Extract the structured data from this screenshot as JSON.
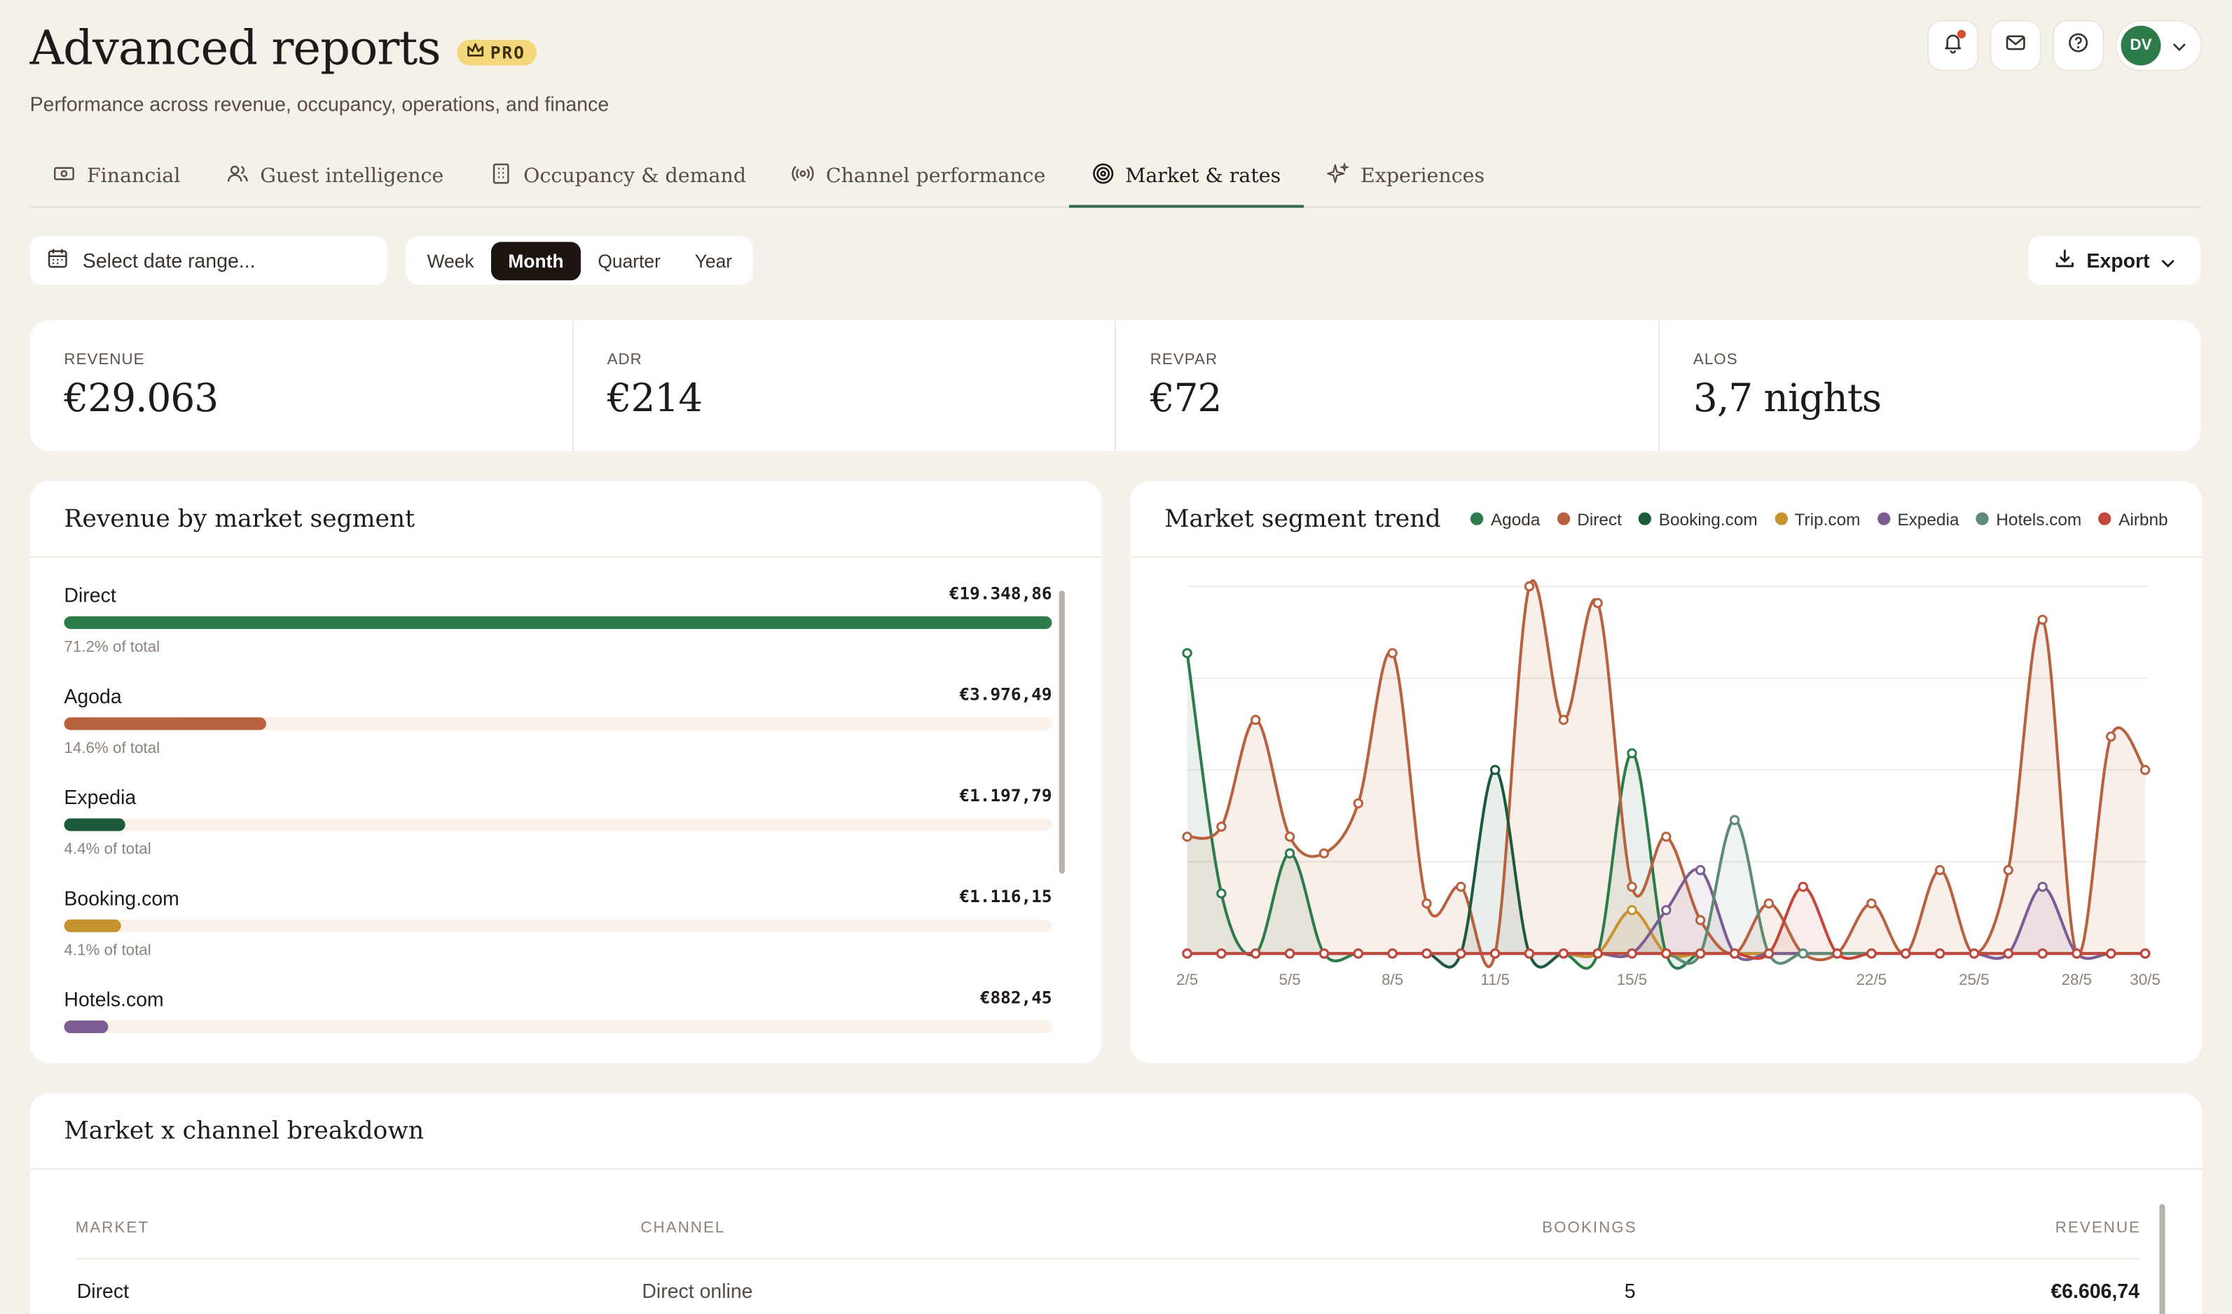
{
  "header": {
    "title": "Advanced reports",
    "badge": "PRO",
    "subtitle": "Performance across revenue, occupancy, operations, and finance",
    "user_initials": "DV"
  },
  "tabs": [
    {
      "label": "Financial",
      "icon": "banknote-icon"
    },
    {
      "label": "Guest intelligence",
      "icon": "users-icon"
    },
    {
      "label": "Occupancy & demand",
      "icon": "building-icon"
    },
    {
      "label": "Channel performance",
      "icon": "broadcast-icon"
    },
    {
      "label": "Market & rates",
      "icon": "target-icon",
      "active": true
    },
    {
      "label": "Experiences",
      "icon": "sparkles-icon"
    }
  ],
  "toolbar": {
    "date_placeholder": "Select date range...",
    "periods": [
      "Week",
      "Month",
      "Quarter",
      "Year"
    ],
    "active_period": "Month",
    "export_label": "Export"
  },
  "kpis": [
    {
      "label": "REVENUE",
      "value": "€29.063"
    },
    {
      "label": "ADR",
      "value": "€214"
    },
    {
      "label": "REVPAR",
      "value": "€72"
    },
    {
      "label": "ALOS",
      "value": "3,7 nights"
    }
  ],
  "segments_card": {
    "title": "Revenue by market segment",
    "items": [
      {
        "name": "Direct",
        "amount": "€19.348,86",
        "pct": "71.2% of total",
        "share": 1.0,
        "color": "#2d7a4b"
      },
      {
        "name": "Agoda",
        "amount": "€3.976,49",
        "pct": "14.6% of total",
        "share": 0.205,
        "color": "#b8613f"
      },
      {
        "name": "Expedia",
        "amount": "€1.197,79",
        "pct": "4.4% of total",
        "share": 0.062,
        "color": "#1d5a3c"
      },
      {
        "name": "Booking.com",
        "amount": "€1.116,15",
        "pct": "4.1% of total",
        "share": 0.058,
        "color": "#c6922f"
      },
      {
        "name": "Hotels.com",
        "amount": "€882,45",
        "pct": "",
        "share": 0.045,
        "color": "#7d5c94"
      }
    ]
  },
  "trend_card": {
    "title": "Market segment trend"
  },
  "chart_data": {
    "type": "line",
    "x": [
      "2/5",
      "3/5",
      "4/5",
      "5/5",
      "6/5",
      "7/5",
      "8/5",
      "9/5",
      "10/5",
      "11/5",
      "12/5",
      "13/5",
      "14/5",
      "15/5",
      "16/5",
      "17/5",
      "18/5",
      "19/5",
      "20/5",
      "21/5",
      "22/5",
      "23/5",
      "24/5",
      "25/5",
      "26/5",
      "27/5",
      "28/5",
      "29/5",
      "30/5"
    ],
    "xticks": [
      "2/5",
      "5/5",
      "8/5",
      "11/5",
      "15/5",
      "22/5",
      "25/5",
      "28/5",
      "30/5"
    ],
    "series": [
      {
        "name": "Agoda",
        "color": "#2d7a4b",
        "values": [
          900,
          180,
          0,
          300,
          0,
          0,
          0,
          0,
          0,
          0,
          0,
          0,
          0,
          600,
          0,
          0,
          0,
          0,
          0,
          0,
          0,
          0,
          0,
          0,
          0,
          0,
          0,
          0,
          0
        ]
      },
      {
        "name": "Direct",
        "color": "#b8613f",
        "values": [
          350,
          380,
          700,
          350,
          300,
          450,
          900,
          150,
          200,
          0,
          1100,
          700,
          1050,
          200,
          350,
          100,
          0,
          150,
          0,
          0,
          150,
          0,
          250,
          0,
          250,
          1000,
          0,
          650,
          550
        ]
      },
      {
        "name": "Booking.com",
        "color": "#1d5a3c",
        "values": [
          0,
          0,
          0,
          0,
          0,
          0,
          0,
          0,
          0,
          550,
          0,
          0,
          0,
          0,
          0,
          0,
          0,
          0,
          0,
          0,
          0,
          0,
          0,
          0,
          0,
          0,
          0,
          0,
          0
        ]
      },
      {
        "name": "Trip.com",
        "color": "#c6922f",
        "values": [
          0,
          0,
          0,
          0,
          0,
          0,
          0,
          0,
          0,
          0,
          0,
          0,
          0,
          130,
          0,
          0,
          0,
          0,
          0,
          0,
          0,
          0,
          0,
          0,
          0,
          0,
          0,
          0,
          0
        ]
      },
      {
        "name": "Expedia",
        "color": "#7d5c94",
        "values": [
          0,
          0,
          0,
          0,
          0,
          0,
          0,
          0,
          0,
          0,
          0,
          0,
          0,
          0,
          130,
          250,
          0,
          0,
          0,
          0,
          0,
          0,
          0,
          0,
          0,
          200,
          0,
          0,
          0
        ]
      },
      {
        "name": "Hotels.com",
        "color": "#5e8b73",
        "values": [
          0,
          0,
          0,
          0,
          0,
          0,
          0,
          0,
          0,
          0,
          0,
          0,
          0,
          0,
          0,
          0,
          400,
          0,
          0,
          0,
          0,
          0,
          0,
          0,
          0,
          0,
          0,
          0,
          0
        ]
      },
      {
        "name": "Airbnb",
        "color": "#c2463a",
        "values": [
          0,
          0,
          0,
          0,
          0,
          0,
          0,
          0,
          0,
          0,
          0,
          0,
          0,
          0,
          0,
          0,
          0,
          0,
          200,
          0,
          0,
          0,
          0,
          0,
          0,
          0,
          0,
          0,
          0
        ]
      }
    ]
  },
  "breakdown_card": {
    "title": "Market x channel breakdown",
    "columns": [
      "MARKET",
      "CHANNEL",
      "BOOKINGS",
      "REVENUE"
    ],
    "rows": [
      {
        "market": "Direct",
        "channel": "Direct online",
        "bookings": "5",
        "revenue": "€6.606,74"
      }
    ]
  }
}
